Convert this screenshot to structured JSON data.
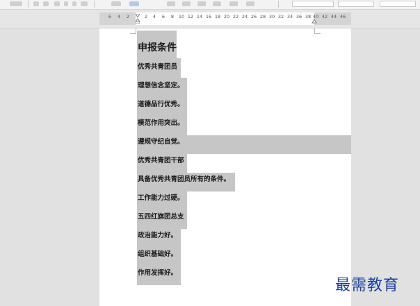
{
  "ruler": {
    "ticks": [
      "6",
      "4",
      "2",
      "2",
      "4",
      "6",
      "8",
      "10",
      "12",
      "14",
      "16",
      "18",
      "20",
      "22",
      "24",
      "26",
      "28",
      "30",
      "32",
      "34",
      "36",
      "38",
      "40",
      "42",
      "44",
      "46"
    ]
  },
  "document": {
    "heading": "申报条件",
    "lines": [
      "优秀共青团员",
      "理想信念坚定。",
      "道德品行优秀。",
      "模范作用突出。",
      "遵规守纪自觉。",
      "优秀共青团干部",
      "具备优秀共青团员所有的条件。",
      "工作能力过硬。",
      "五四红旗团总支",
      "政治能力好。",
      "组织基础好。",
      "作用发挥好。"
    ]
  },
  "watermark": "最需教育",
  "colors": {
    "selection": "#c6c6c6",
    "watermark": "#1d3fa3",
    "workspace": "#e1e1e1"
  }
}
